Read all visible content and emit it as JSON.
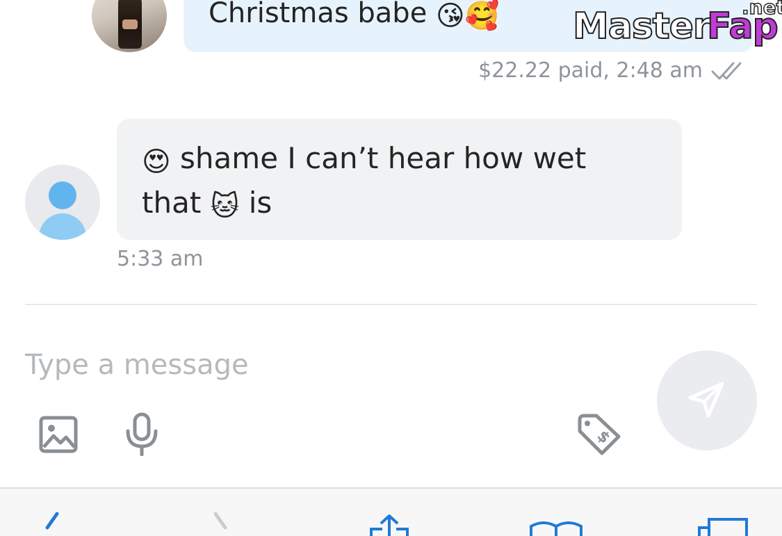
{
  "sent_message": {
    "text": "Christmas babe",
    "emojis": "😘🥰",
    "meta": "$22.22 paid, 2:48 am",
    "read_receipt_icon": "double-check-icon"
  },
  "watermark": {
    "part1": "Master",
    "part2": "Fap",
    "part3": ".net"
  },
  "received_message": {
    "emoji_start": "😍",
    "line1_text": " shame I can’t hear how wet",
    "line2_start": "that ",
    "emoji_mid": "🐱",
    "line2_end": " is",
    "time": "5:33 am"
  },
  "composer": {
    "placeholder": "Type a message",
    "value": "",
    "tools": [
      "image-icon",
      "microphone-icon",
      "price-tag-icon"
    ],
    "send_icon": "paper-plane-icon"
  },
  "browser_toolbar": {
    "buttons": [
      "back-icon",
      "forward-icon",
      "share-icon",
      "bookmarks-icon",
      "tabs-icon"
    ]
  },
  "colors": {
    "sent_bubble": "#e7f3fc",
    "received_bubble": "#f1f2f4",
    "meta_text": "#8f949a",
    "icon_gray": "#8a8f94",
    "link_blue": "#1f7ad6"
  }
}
